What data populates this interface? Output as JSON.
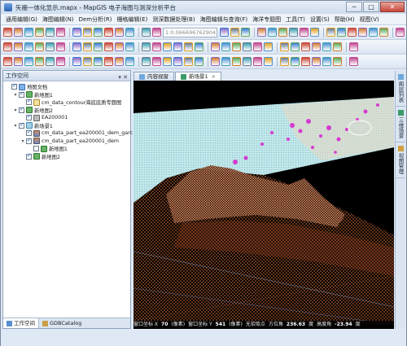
{
  "window": {
    "title": "矢栅一体化显示.mapx - MapGIS 电子海图与测深分析平台",
    "controls": [
      "─",
      "□",
      "✕"
    ]
  },
  "menu": [
    "通用编辑(G)",
    "海图编辑(N)",
    "Dem分析(R)",
    "栅格编辑(E)",
    "测深数据处理(B)",
    "海图编辑与查询(F)",
    "海洋专题图",
    "工具(T)",
    "设置(S)",
    "帮助(H)",
    "视图(V)"
  ],
  "toolbar": {
    "scale_combo": "1:0.0666967629041..."
  },
  "workspace": {
    "title": "工作空间",
    "pin": "▾ ✕",
    "tree": [
      {
        "label": "地图文档",
        "indent": 0,
        "toggle": "",
        "check": true,
        "icon": "doc"
      },
      {
        "label": "新地图1",
        "indent": 1,
        "toggle": "▾",
        "check": true,
        "icon": "map"
      },
      {
        "label": "cm_data_contour海底底质专题图",
        "indent": 2,
        "toggle": "",
        "check": true,
        "icon": "layer"
      },
      {
        "label": "新地图2",
        "indent": 1,
        "toggle": "▾",
        "check": true,
        "icon": "map"
      },
      {
        "label": "EA200001",
        "indent": 2,
        "toggle": "",
        "check": true,
        "icon": "raster"
      },
      {
        "label": "新场景1",
        "indent": 1,
        "toggle": "▾",
        "check": true,
        "icon": "scene"
      },
      {
        "label": "cm_data_part_ea200001_dem_garc",
        "indent": 2,
        "toggle": "",
        "check": true,
        "icon": "dem"
      },
      {
        "label": "cm_data_part_ea200001_dem",
        "indent": 2,
        "toggle": "▾",
        "check": true,
        "icon": "dem"
      },
      {
        "label": "新地图1",
        "indent": 3,
        "toggle": "",
        "check": false,
        "icon": "map"
      },
      {
        "label": "新地图2",
        "indent": 2,
        "toggle": "",
        "check": true,
        "icon": "map"
      }
    ]
  },
  "left_tabs": [
    "工作空间",
    "GDBCatalog"
  ],
  "doc_tabs": [
    "内容视窗",
    "新场景1"
  ],
  "right_tabs": [
    "图层列表",
    "三维场景",
    "视图管理"
  ],
  "status": {
    "win_x_label": "窗口坐标 X",
    "win_x": "70",
    "win_x_unit": "(像素)",
    "win_y_label": "窗口坐标 Y",
    "win_y": "541",
    "win_y_unit": "(像素)",
    "pick_state": "无拾取点",
    "azimuth_label": "方位角",
    "azimuth": "236.63",
    "azimuth_unit": "度",
    "elevation_label": "高度角",
    "elevation": "-23.94",
    "elevation_unit": "度"
  },
  "colors": {
    "terrain_top": "#bfe7ea",
    "terrain_mesh": "#d97a45",
    "accent_magenta": "#d53ad0"
  }
}
